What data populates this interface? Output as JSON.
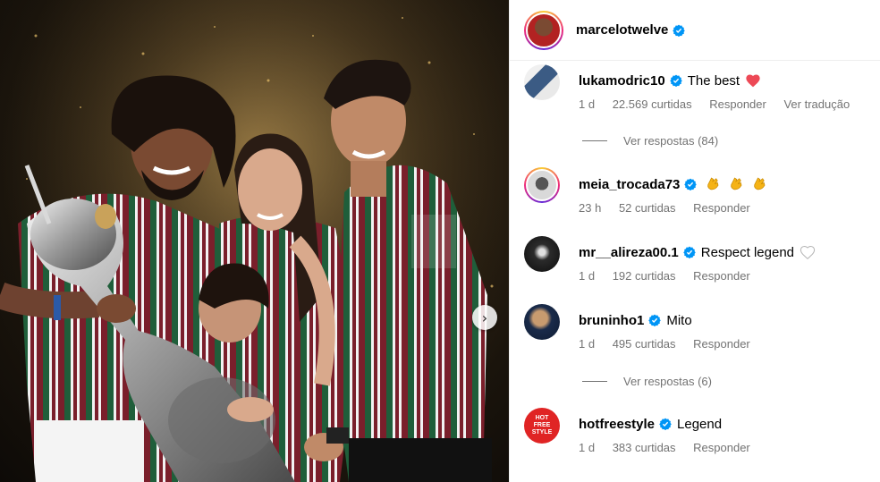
{
  "post": {
    "username": "marcelotwelve",
    "carousel_next_icon": "chevron-right-icon"
  },
  "comments": [
    {
      "username": "lukamodric10",
      "text": "The best",
      "emoji": "heart-red",
      "time": "1 d",
      "likes": "22.569 curtidas",
      "reply": "Responder",
      "translate": "Ver tradução",
      "replies": "Ver respostas (84)"
    },
    {
      "username": "meia_trocada73",
      "text": "",
      "emoji": "clapping-hands x3",
      "time": "23 h",
      "likes": "52 curtidas",
      "reply": "Responder"
    },
    {
      "username": "mr__alireza00.1",
      "text": "Respect legend",
      "emoji": "heart-outline",
      "time": "1 d",
      "likes": "192 curtidas",
      "reply": "Responder"
    },
    {
      "username": "bruninho1",
      "text": "Mito",
      "time": "1 d",
      "likes": "495 curtidas",
      "reply": "Responder",
      "replies": "Ver respostas (6)"
    },
    {
      "username": "hotfreestyle",
      "text": "Legend",
      "avatar_text": "HOT FREE STYLE",
      "time": "1 d",
      "likes": "383 curtidas",
      "reply": "Responder"
    }
  ],
  "colors": {
    "verified": "#0095f6",
    "meta": "#737373",
    "heart": "#ed4956",
    "jersey_maroon": "#7a1f2b",
    "jersey_green": "#1f5e3a"
  }
}
